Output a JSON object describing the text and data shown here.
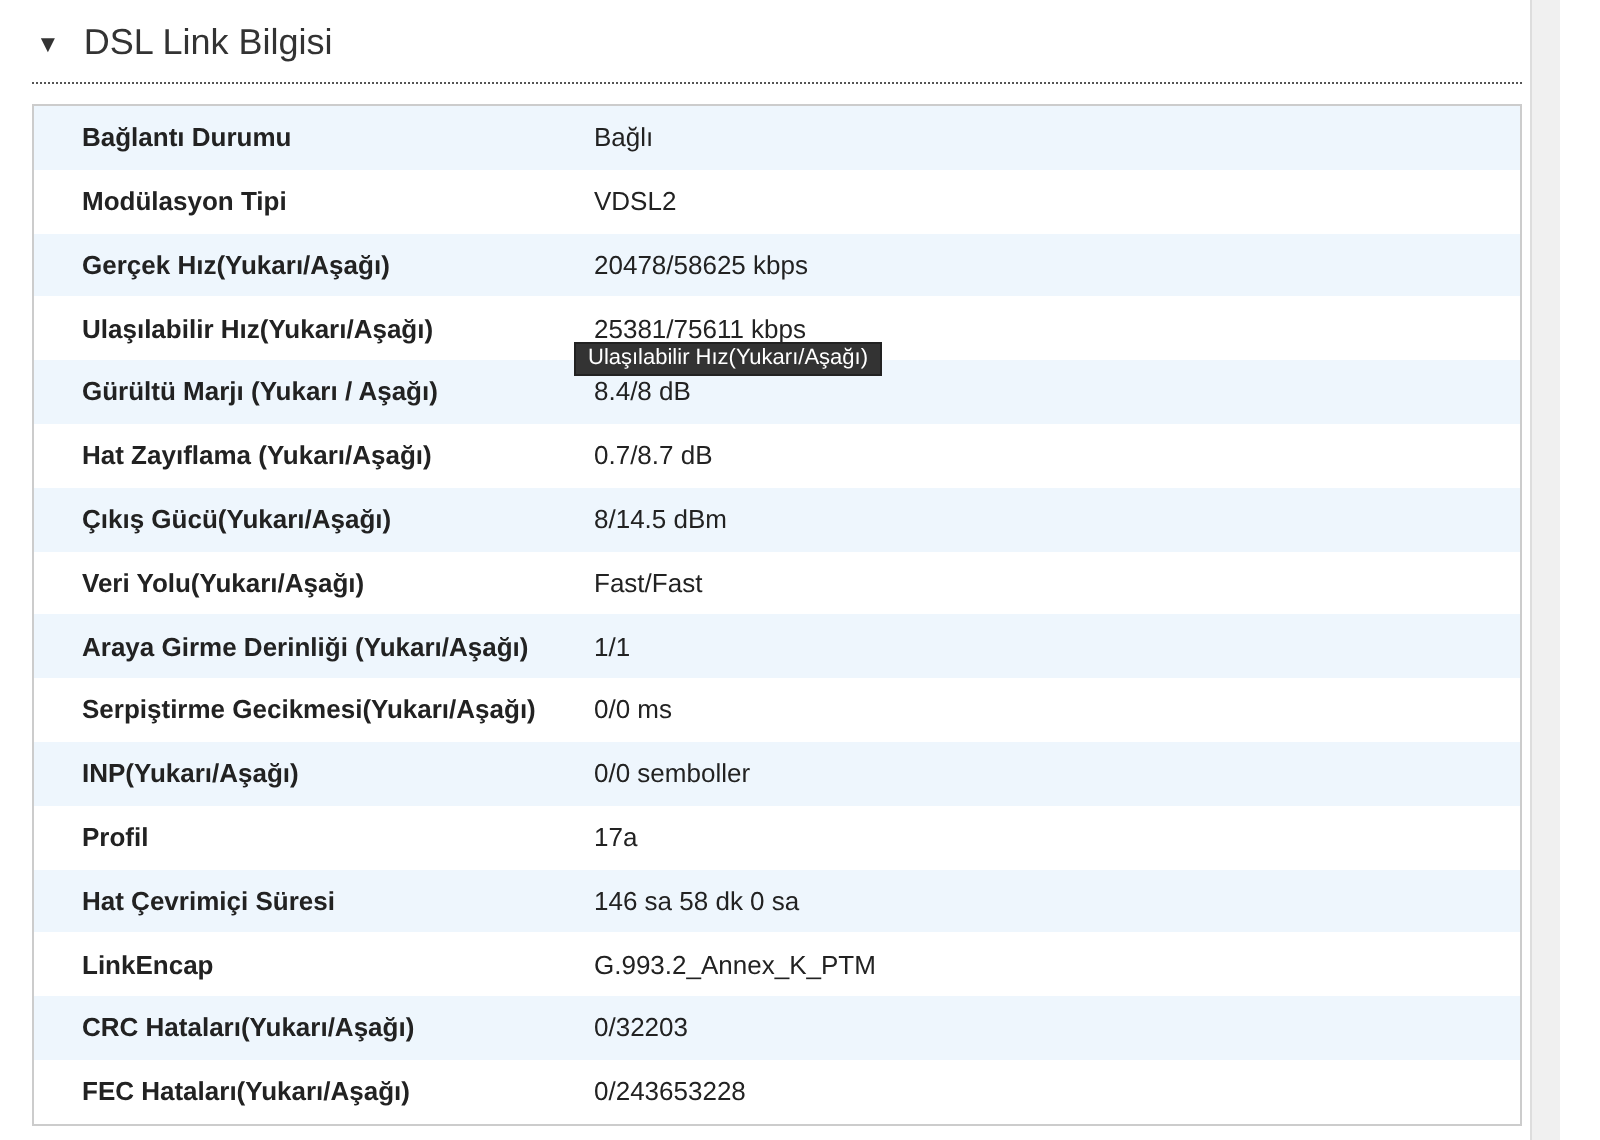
{
  "section": {
    "caret": "▼",
    "title": "DSL Link Bilgisi",
    "expanded": true
  },
  "rows": [
    {
      "label": "Bağlantı Durumu",
      "value": "Bağlı"
    },
    {
      "label": "Modülasyon Tipi",
      "value": "VDSL2"
    },
    {
      "label": "Gerçek Hız(Yukarı/Aşağı)",
      "value": "20478/58625 kbps"
    },
    {
      "label": "Ulaşılabilir Hız(Yukarı/Aşağı)",
      "value": "25381/75611 kbps"
    },
    {
      "label": "Gürültü Marjı (Yukarı / Aşağı)",
      "value": "8.4/8 dB"
    },
    {
      "label": "Hat Zayıflama (Yukarı/Aşağı)",
      "value": "0.7/8.7 dB"
    },
    {
      "label": "Çıkış Gücü(Yukarı/Aşağı)",
      "value": "8/14.5 dBm"
    },
    {
      "label": "Veri Yolu(Yukarı/Aşağı)",
      "value": "Fast/Fast"
    },
    {
      "label": "Araya Girme Derinliği (Yukarı/Aşağı)",
      "value": "1/1"
    },
    {
      "label": "Serpiştirme Gecikmesi(Yukarı/Aşağı)",
      "value": "0/0 ms"
    },
    {
      "label": "INP(Yukarı/Aşağı)",
      "value": "0/0 semboller"
    },
    {
      "label": "Profil",
      "value": "17a"
    },
    {
      "label": "Hat Çevrimiçi Süresi",
      "value": "146 sa 58 dk 0 sa"
    },
    {
      "label": "LinkEncap",
      "value": "G.993.2_Annex_K_PTM"
    },
    {
      "label": "CRC Hataları(Yukarı/Aşağı)",
      "value": "0/32203"
    },
    {
      "label": "FEC Hataları(Yukarı/Aşağı)",
      "value": "0/243653228"
    }
  ],
  "tooltip": "Ulaşılabilir Hız(Yukarı/Aşağı)"
}
